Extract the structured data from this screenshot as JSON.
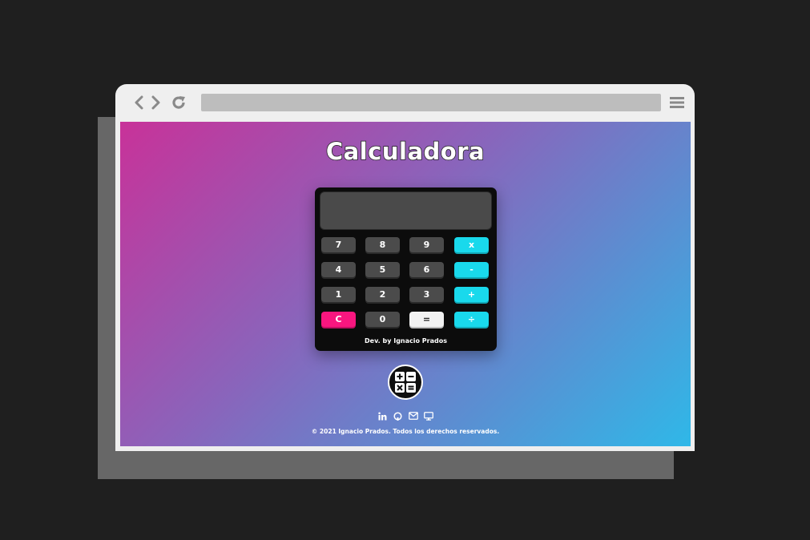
{
  "page": {
    "title": "Calculadora"
  },
  "calculator": {
    "display_value": "",
    "keys": [
      {
        "label": "7",
        "kind": "digit"
      },
      {
        "label": "8",
        "kind": "digit"
      },
      {
        "label": "9",
        "kind": "digit"
      },
      {
        "label": "x",
        "kind": "operator"
      },
      {
        "label": "4",
        "kind": "digit"
      },
      {
        "label": "5",
        "kind": "digit"
      },
      {
        "label": "6",
        "kind": "digit"
      },
      {
        "label": "-",
        "kind": "operator"
      },
      {
        "label": "1",
        "kind": "digit"
      },
      {
        "label": "2",
        "kind": "digit"
      },
      {
        "label": "3",
        "kind": "digit"
      },
      {
        "label": "+",
        "kind": "operator"
      },
      {
        "label": "C",
        "kind": "clear"
      },
      {
        "label": "0",
        "kind": "digit"
      },
      {
        "label": "=",
        "kind": "equals"
      },
      {
        "label": "÷",
        "kind": "operator"
      }
    ],
    "credit": "Dev. by Ignacio Prados"
  },
  "footer": {
    "social_icons": [
      "linkedin-icon",
      "github-icon",
      "mail-icon",
      "portfolio-icon"
    ],
    "copyright": "© 2021 Ignacio Prados. Todos los derechos reservados."
  },
  "colors": {
    "operator": "#19d9ec",
    "clear": "#f8167f",
    "equals": "#f2f2f2",
    "digit": "#4b4b4b",
    "gradient_start": "#c83299",
    "gradient_end": "#2fb8e8"
  }
}
